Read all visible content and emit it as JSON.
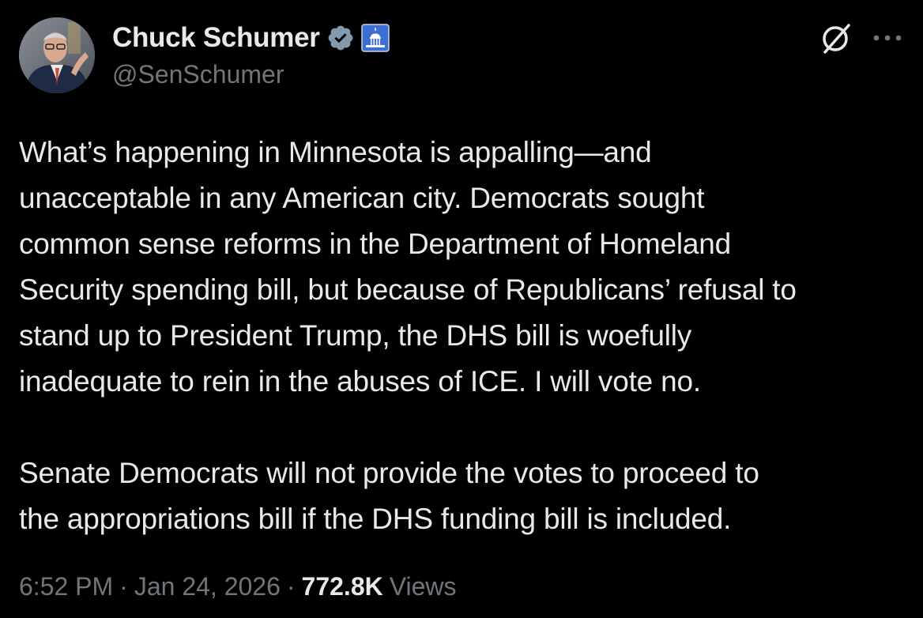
{
  "author": {
    "display_name": "Chuck Schumer",
    "handle": "@SenSchumer",
    "avatar_icon": "avatar-photo",
    "verified_icon": "verified-badge-icon",
    "affiliation_icon": "capitol-building-icon"
  },
  "tweet": {
    "text": "What’s happening in Minnesota is appalling—and\nunacceptable in any American city. Democrats sought\ncommon sense reforms in the Department of Homeland\nSecurity spending bill, but because of Republicans’ refusal to\nstand up to President Trump, the DHS bill is woefully\ninadequate to rein in the abuses of ICE. I will vote no.\n\nSenate Democrats will not provide the votes to proceed to\nthe appropriations bill if the DHS funding bill is included."
  },
  "meta": {
    "time": "6:52 PM",
    "separator": "·",
    "date": "Jan 24, 2026",
    "views_count": "772.8K",
    "views_label": "Views"
  },
  "colors": {
    "background": "#000000",
    "primary_text": "#e7e9ea",
    "secondary_text": "#71767b",
    "verified_badge": "#829aab",
    "capitol_badge": "#3b6fd4"
  }
}
